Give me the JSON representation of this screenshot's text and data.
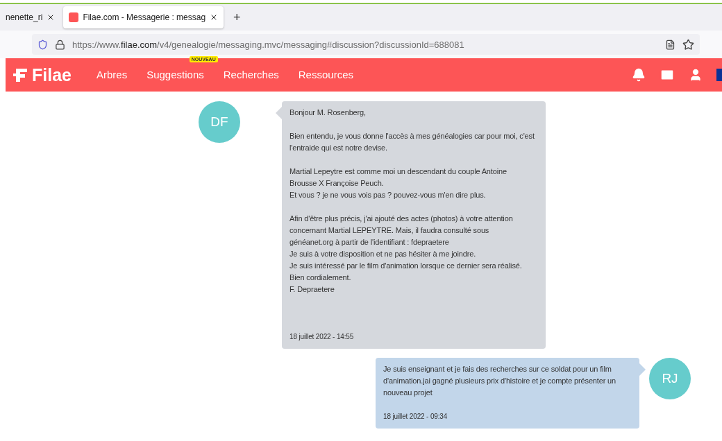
{
  "browser": {
    "tabs": [
      {
        "title": "nenette_ri",
        "selected": false
      },
      {
        "title": "Filae.com - Messagerie : messag",
        "selected": true
      }
    ],
    "new_tab": "+",
    "url": {
      "prefix": "https://www.",
      "domain": "filae.com",
      "path": "/v4/genealogie/messaging.mvc/messaging#discussion?discussionId=688081"
    }
  },
  "nav": {
    "logo": "Filae",
    "items": [
      {
        "label": "Arbres"
      },
      {
        "label": "Suggestions",
        "badge": "NOUVEAU"
      },
      {
        "label": "Recherches"
      },
      {
        "label": "Ressources"
      }
    ]
  },
  "messages": [
    {
      "kind": "received",
      "initials": "DF",
      "paragraphs": [
        [
          "Bonjour M. Rosenberg,"
        ],
        [
          "Bien entendu, je vous donne l'accès à mes généalogies car pour moi, c'est",
          "l'entraide qui est notre devise."
        ],
        [
          "Martial Lepeytre est comme moi un descendant du couple Antoine",
          "Brousse X Françoise Peuch.",
          "Et vous ? je ne vous vois pas ? pouvez-vous m'en dire plus."
        ],
        [
          "Afin d'être plus précis, j'ai ajouté des actes (photos) à votre attention",
          "concernant Martial LEPEYTRE. Mais, il faudra consulté sous",
          "généanet.org à partir de l'identifiant : fdepraetere",
          "Je suis à votre disposition et ne pas hésiter à me joindre.",
          "Je suis intéressé par le film d'animation lorsque ce dernier sera réalisé.",
          "Bien cordialement.",
          "F. Depraetere"
        ]
      ],
      "date": "18 juillet 2022 - 14:55"
    },
    {
      "kind": "sent",
      "initials": "RJ",
      "paragraphs": [
        [
          "Je suis enseignant et je fais des recherches sur ce soldat pour un film",
          "d'animation.jai gagné plusieurs prix d'histoire et je compte présenter un",
          "nouveau projet"
        ]
      ],
      "date": "18 juillet 2022 - 09:34"
    }
  ]
}
